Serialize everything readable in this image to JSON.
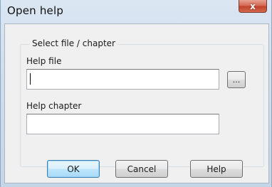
{
  "window": {
    "title": "Open help",
    "close_glyph": "x"
  },
  "group": {
    "legend": "Select file / chapter"
  },
  "help_file": {
    "label": "Help file",
    "value": "",
    "browse_label": "..."
  },
  "help_chapter": {
    "label": "Help chapter",
    "value": ""
  },
  "buttons": {
    "ok": "OK",
    "cancel": "Cancel",
    "help": "Help"
  },
  "colors": {
    "default_button_border": "#3c7fb1",
    "close_button": "#c2432b"
  }
}
